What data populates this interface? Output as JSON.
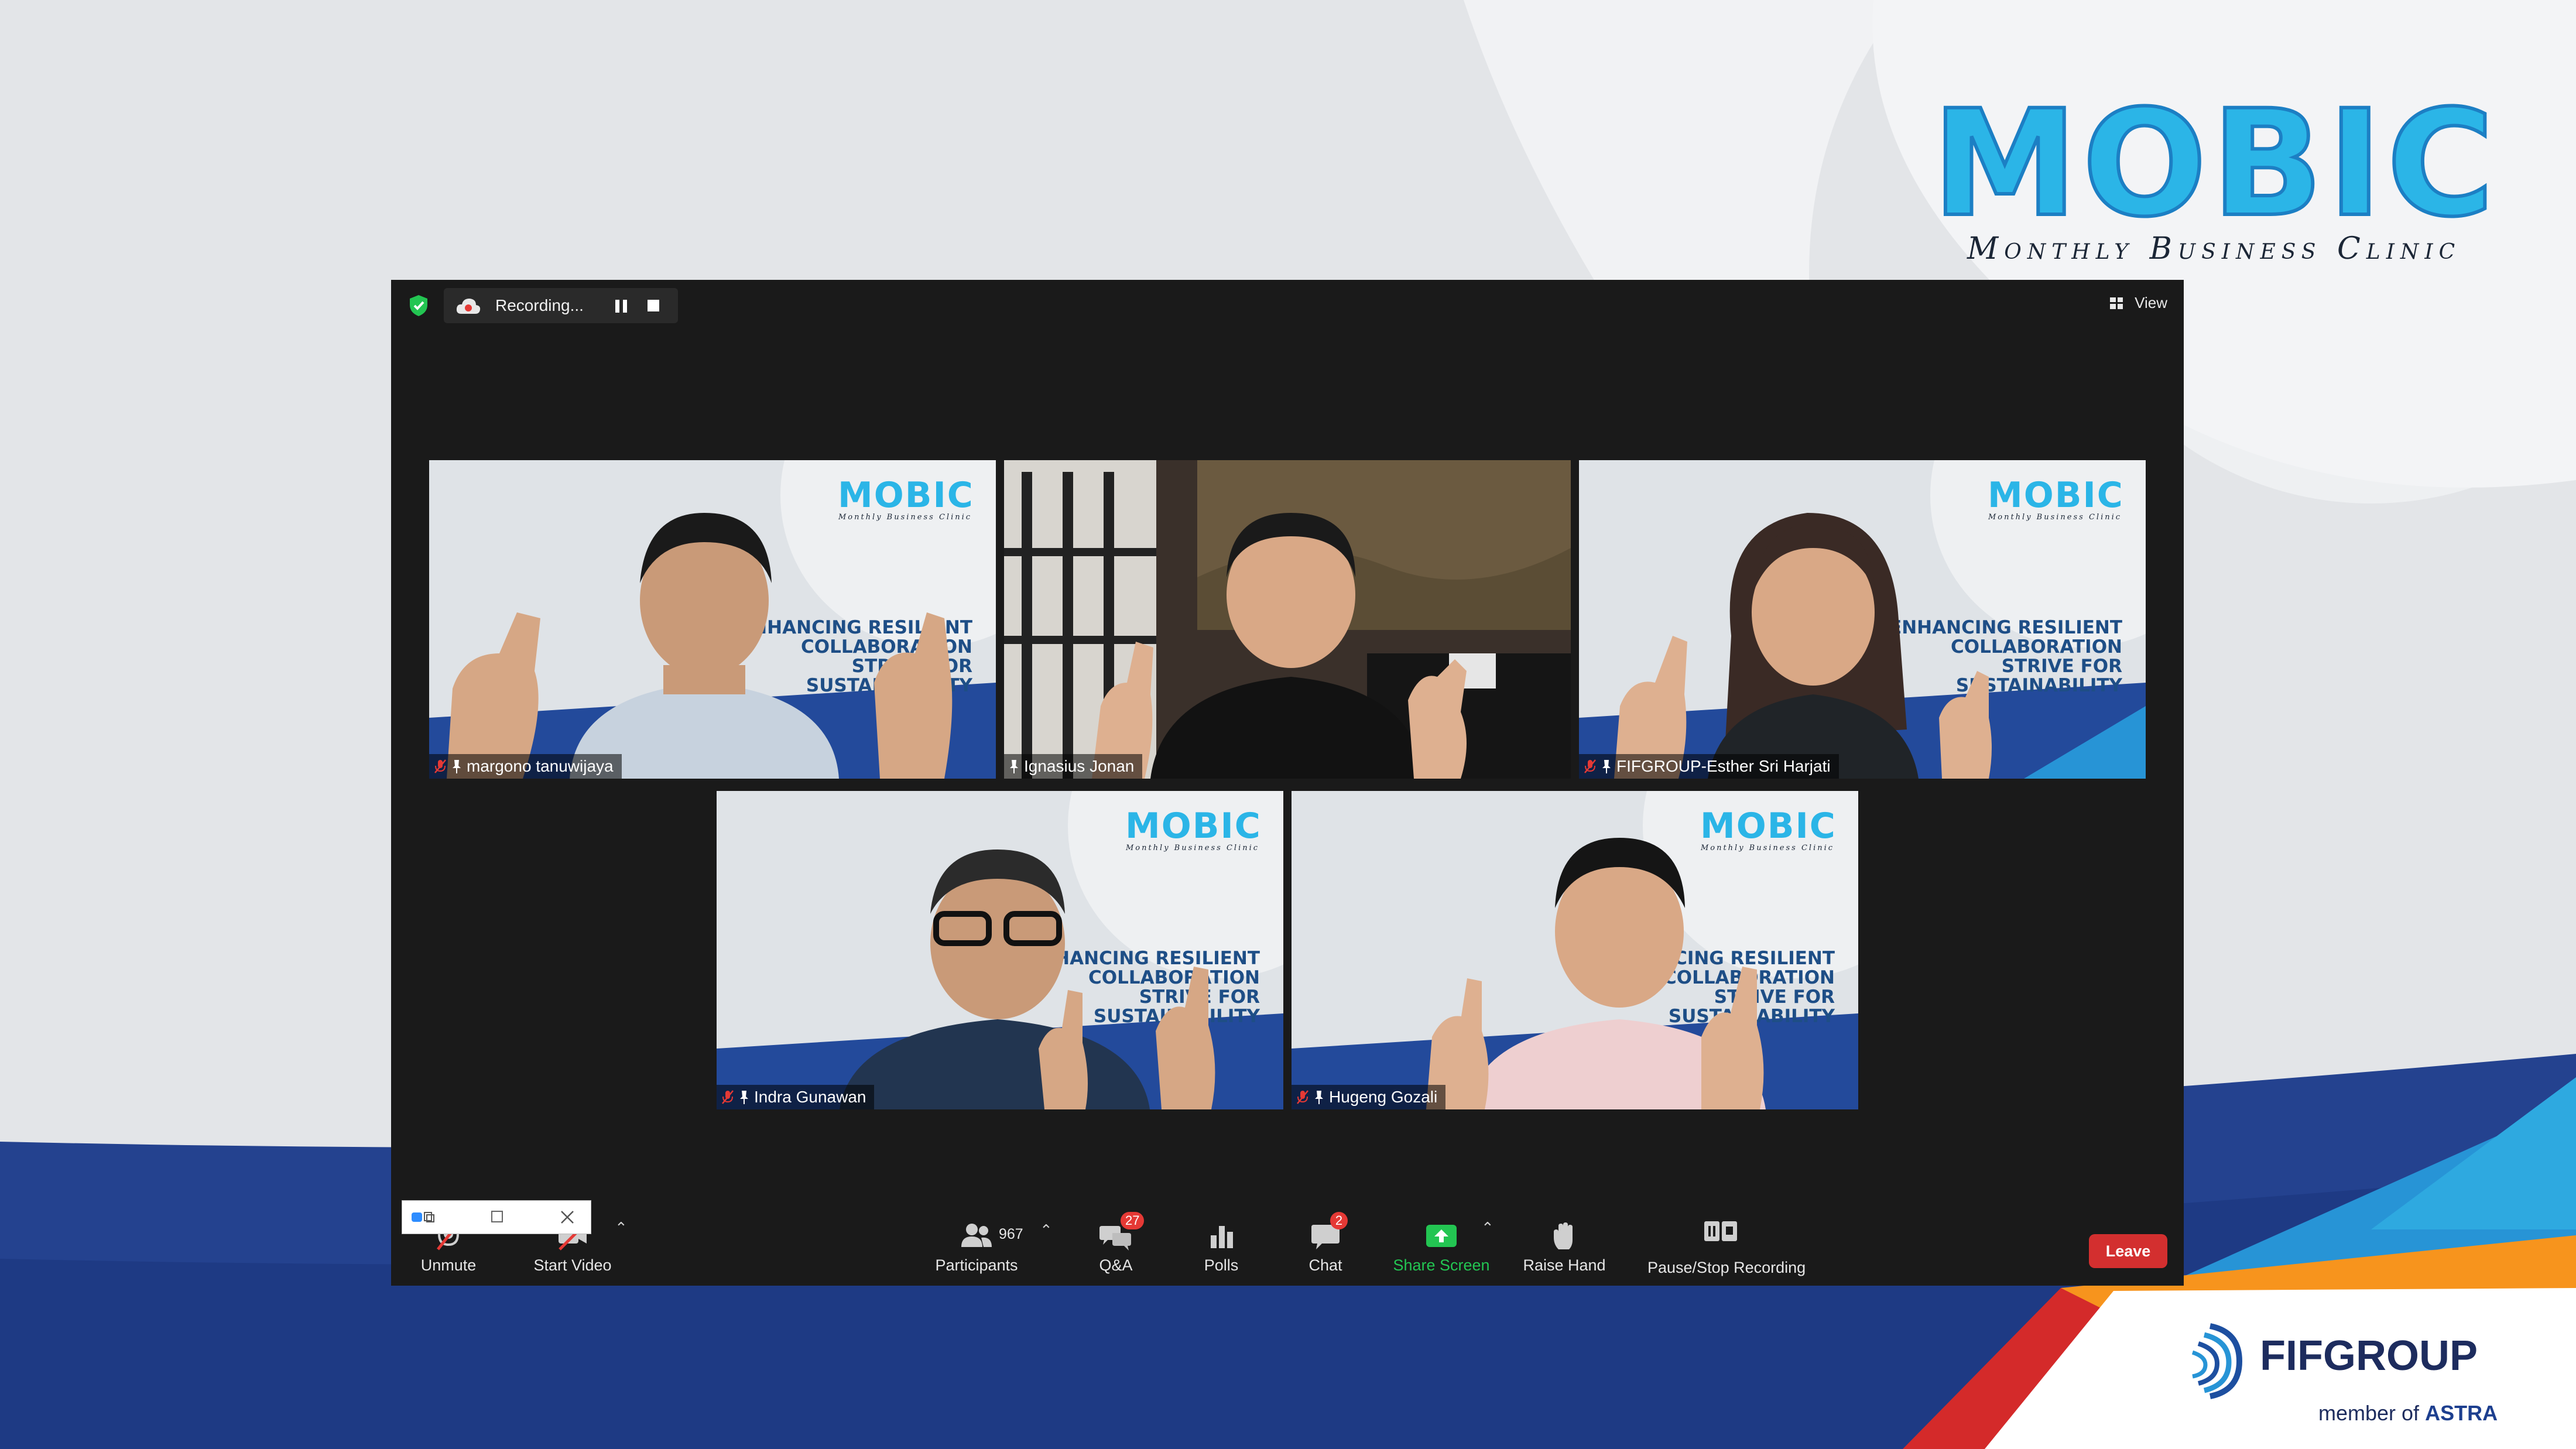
{
  "branding": {
    "logo_title": "MOBIC",
    "logo_subtitle": "Monthly Business Clinic",
    "sponsor_name": "FIFGROUP",
    "sponsor_member_prefix": "member of",
    "sponsor_member_brand": "ASTRA"
  },
  "meeting": {
    "recording_status": "Recording...",
    "view_label": "View",
    "participants": [
      {
        "name": "margono tanuwijaya",
        "muted": true,
        "pinned": true
      },
      {
        "name": "Ignasius Jonan",
        "muted": false,
        "pinned": true
      },
      {
        "name": "FIFGROUP-Esther Sri Harjati",
        "muted": true,
        "pinned": true
      },
      {
        "name": "Indra Gunawan",
        "muted": true,
        "pinned": true
      },
      {
        "name": "Hugeng Gozali",
        "muted": true,
        "pinned": true
      }
    ],
    "slide_logo_title": "MOBIC",
    "slide_logo_subtitle": "Monthly Business Clinic",
    "slide_slogan_lines": [
      "ENHANCING RESILIENT",
      "COLLABORATION",
      "STRIVE FOR",
      "SUSTAINABILITY"
    ]
  },
  "toolbar": {
    "unmute_label": "Unmute",
    "start_video_label": "Start Video",
    "participants_label": "Participants",
    "participants_count": "967",
    "qa_label": "Q&A",
    "qa_badge": "27",
    "polls_label": "Polls",
    "chat_label": "Chat",
    "chat_badge": "2",
    "share_screen_label": "Share Screen",
    "raise_hand_label": "Raise Hand",
    "pause_stop_recording_label": "Pause/Stop Recording",
    "leave_label": "Leave"
  },
  "colors": {
    "accent_blue": "#2bb5e7",
    "brand_navy": "#1d2c5e",
    "share_green": "#23c552",
    "leave_red": "#d32f2f",
    "badge_red": "#e53935"
  }
}
